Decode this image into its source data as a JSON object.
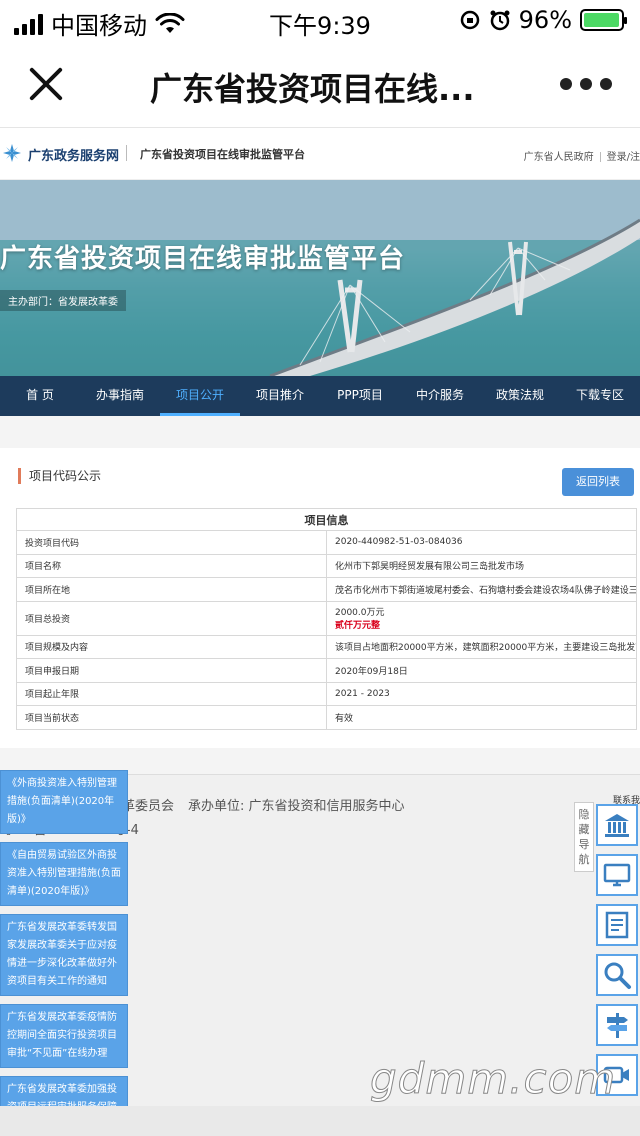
{
  "status_bar": {
    "carrier": "中国移动",
    "time": "下午9:39",
    "battery": "96%",
    "battery_level": 0.96
  },
  "nav_bar": {
    "title": "广东省投资项目在线..."
  },
  "site_header": {
    "logo_text": "广东政务服务网",
    "platform_text": "广东省投资项目在线审批监管平台",
    "right_link1": "广东省人民政府",
    "right_link2": "登录/注"
  },
  "banner": {
    "title": "广东省投资项目在线审批监管平台",
    "sponsor": "主办部门：省发展改革委"
  },
  "main_nav": {
    "items": [
      "首 页",
      "办事指南",
      "项目公开",
      "项目推介",
      "PPP项目",
      "中介服务",
      "政策法规",
      "下载专区"
    ],
    "active_index": 2
  },
  "panel": {
    "title": "项目代码公示",
    "back_button": "返回列表",
    "table_header": "项目信息",
    "rows": [
      {
        "key": "投资项目代码",
        "value": "2020-440982-51-03-084036"
      },
      {
        "key": "项目名称",
        "value": "化州市下郭昊明经贸发展有限公司三岛批发市场"
      },
      {
        "key": "项目所在地",
        "value": "茂名市化州市下郭街道坡尾村委会、石狗塘村委会建设农场4队佛子岭建设三岛批发市场"
      },
      {
        "key": "项目总投资",
        "value": "2000.0万元",
        "value2": "贰仟万元整"
      },
      {
        "key": "项目规模及内容",
        "value": "该项目占地面积20000平方米，建筑面积20000平方米，主要建设三岛批发市场的商铺等，主要产品是各类家禽的批发、零售"
      },
      {
        "key": "项目申报日期",
        "value": "2020年09月18日"
      },
      {
        "key": "项目起止年限",
        "value": "2021 - 2023"
      },
      {
        "key": "项目当前状态",
        "value": "有效"
      }
    ]
  },
  "footer": {
    "line1_prefix": "发展和改革委员会",
    "line1_label": "承办单位:",
    "line1_value": "广东省投资和信用服务中心",
    "line2": "粤ICP备07504232号-4",
    "right_text": "联系我"
  },
  "float_cards": [
    "《外商投资准入特别管理措施(负面清单)(2020年版)》",
    "《自由贸易试验区外商投资准入特别管理措施(负面清单)(2020年版)》",
    "广东省发展改革委转发国家发展改革委关于应对疫情进一步深化改革做好外资项目有关工作的通知",
    "广东省发展改革委疫情防控期间全面实行投资项目审批“不见面”在线办理",
    "广东省发展改革委加强投资项目远程审批服务保障疫情防控期间项目办理不"
  ],
  "side_nav": {
    "label": "隐藏导航",
    "icons": [
      "bank-icon",
      "monitor-icon",
      "document-icon",
      "search-icon",
      "signpost-icon",
      "video-icon"
    ]
  },
  "watermark": "gdmm.com"
}
